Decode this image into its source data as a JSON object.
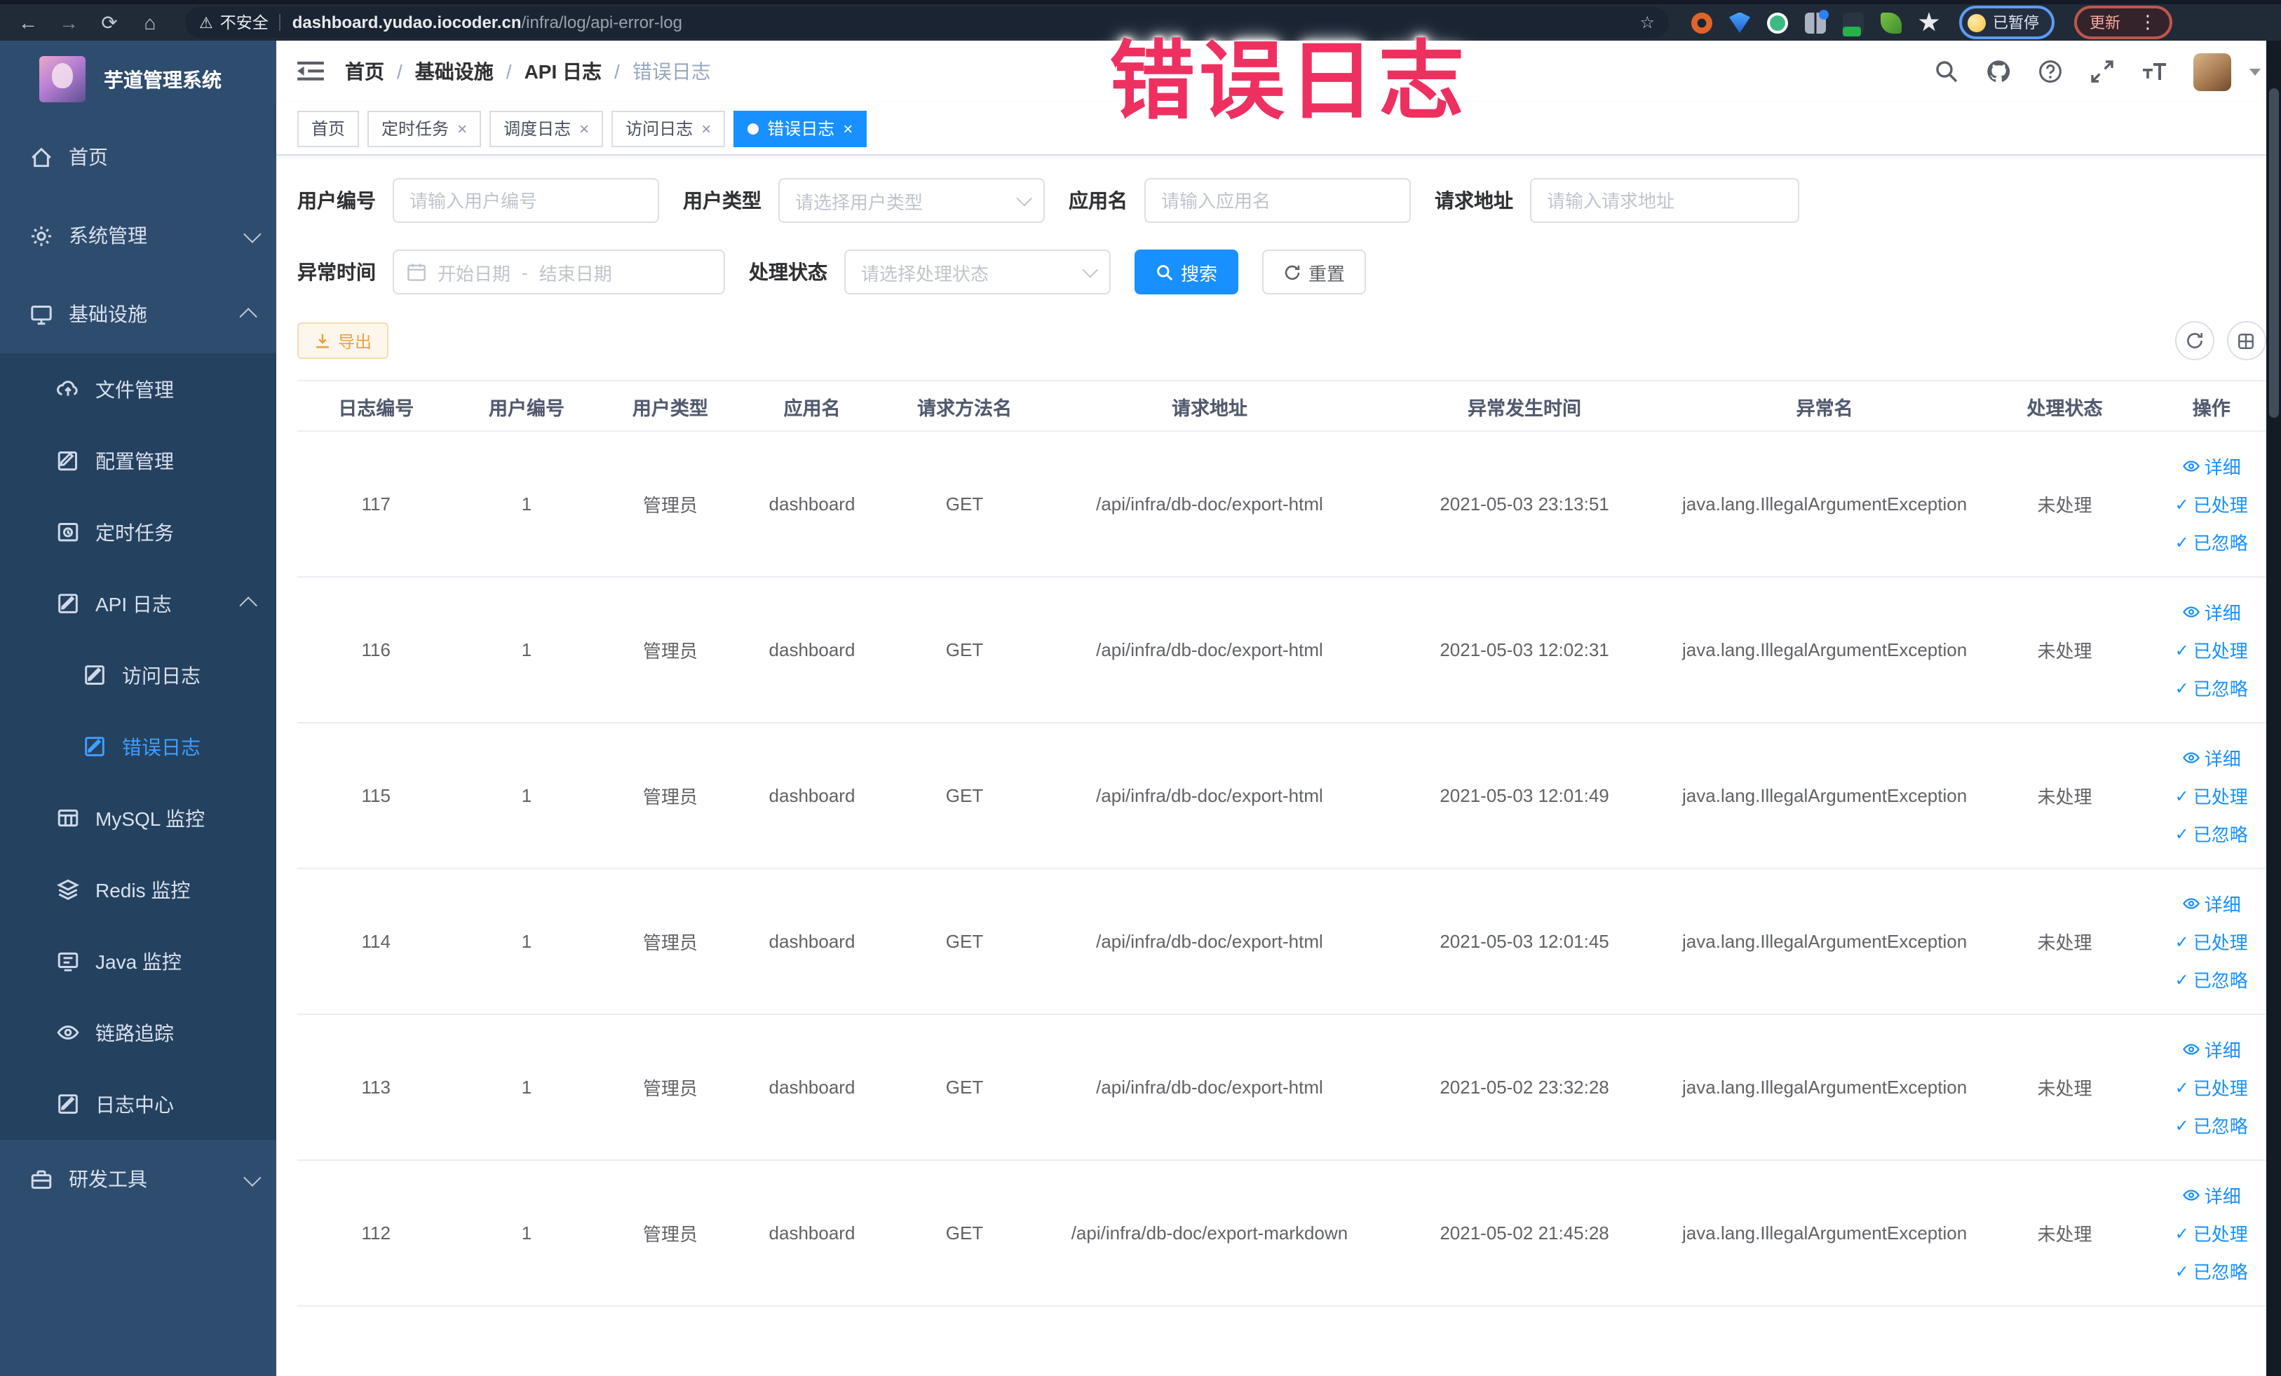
{
  "browser": {
    "security_label": "不安全",
    "url_domain": "dashboard.yudao.iocoder.cn",
    "url_path": "/infra/log/api-error-log",
    "paused_badge": "已暂停",
    "update_button": "更新"
  },
  "icons": {
    "back": "←",
    "forward": "→",
    "reload": "⟳",
    "home": "⌂",
    "warning": "⚠",
    "star": "☆",
    "kebab": "⋮",
    "close": "×",
    "check": "✓",
    "question": "?"
  },
  "annotation": {
    "text": "错误日志",
    "color": "#ee3060"
  },
  "sidebar": {
    "title": "芋道管理系统",
    "home": "首页",
    "system_mgmt": "系统管理",
    "infrastructure": "基础设施",
    "file_mgmt": "文件管理",
    "config_mgmt": "配置管理",
    "scheduled_task": "定时任务",
    "api_log": "API 日志",
    "access_log": "访问日志",
    "error_log": "错误日志",
    "mysql_monitor": "MySQL 监控",
    "redis_monitor": "Redis 监控",
    "java_monitor": "Java 监控",
    "trace": "链路追踪",
    "log_center": "日志中心",
    "dev_tools": "研发工具"
  },
  "breadcrumb": {
    "separator": "/",
    "items": [
      "首页",
      "基础设施",
      "API 日志",
      "错误日志"
    ]
  },
  "tabs": [
    {
      "label": "首页"
    },
    {
      "label": "定时任务"
    },
    {
      "label": "调度日志"
    },
    {
      "label": "访问日志"
    },
    {
      "label": "错误日志"
    }
  ],
  "filters": {
    "user_id": {
      "label": "用户编号",
      "placeholder": "请输入用户编号"
    },
    "user_type": {
      "label": "用户类型",
      "placeholder": "请选择用户类型"
    },
    "app_name": {
      "label": "应用名",
      "placeholder": "请输入应用名"
    },
    "request_url": {
      "label": "请求地址",
      "placeholder": "请输入请求地址"
    },
    "exception_time": {
      "label": "异常时间",
      "start_placeholder": "开始日期",
      "separator": "-",
      "end_placeholder": "结束日期"
    },
    "process_status": {
      "label": "处理状态",
      "placeholder": "请选择处理状态"
    },
    "search_button": "搜索",
    "reset_button": "重置"
  },
  "toolbar": {
    "export_button": "导出"
  },
  "table": {
    "columns": [
      "日志编号",
      "用户编号",
      "用户类型",
      "应用名",
      "请求方法名",
      "请求地址",
      "异常发生时间",
      "异常名",
      "处理状态",
      "操作"
    ],
    "actions": {
      "detail": "详细",
      "processed": "已处理",
      "ignored": "已忽略"
    },
    "rows": [
      {
        "id": "117",
        "user_id": "1",
        "user_type": "管理员",
        "app": "dashboard",
        "method": "GET",
        "url": "/api/infra/db-doc/export-html",
        "time": "2021-05-03 23:13:51",
        "exception": "java.lang.IllegalArgumentException",
        "status": "未处理"
      },
      {
        "id": "116",
        "user_id": "1",
        "user_type": "管理员",
        "app": "dashboard",
        "method": "GET",
        "url": "/api/infra/db-doc/export-html",
        "time": "2021-05-03 12:02:31",
        "exception": "java.lang.IllegalArgumentException",
        "status": "未处理"
      },
      {
        "id": "115",
        "user_id": "1",
        "user_type": "管理员",
        "app": "dashboard",
        "method": "GET",
        "url": "/api/infra/db-doc/export-html",
        "time": "2021-05-03 12:01:49",
        "exception": "java.lang.IllegalArgumentException",
        "status": "未处理"
      },
      {
        "id": "114",
        "user_id": "1",
        "user_type": "管理员",
        "app": "dashboard",
        "method": "GET",
        "url": "/api/infra/db-doc/export-html",
        "time": "2021-05-03 12:01:45",
        "exception": "java.lang.IllegalArgumentException",
        "status": "未处理"
      },
      {
        "id": "113",
        "user_id": "1",
        "user_type": "管理员",
        "app": "dashboard",
        "method": "GET",
        "url": "/api/infra/db-doc/export-html",
        "time": "2021-05-02 23:32:28",
        "exception": "java.lang.IllegalArgumentException",
        "status": "未处理"
      },
      {
        "id": "112",
        "user_id": "1",
        "user_type": "管理员",
        "app": "dashboard",
        "method": "GET",
        "url": "/api/infra/db-doc/export-markdown",
        "time": "2021-05-02 21:45:28",
        "exception": "java.lang.IllegalArgumentException",
        "status": "未处理"
      }
    ]
  },
  "colors": {
    "accent": "#1890ff",
    "sidebar_bg": "#2e4c6e",
    "submenu_bg": "#24415f",
    "warn": "#e6a23c",
    "annotation": "#ee3060"
  }
}
